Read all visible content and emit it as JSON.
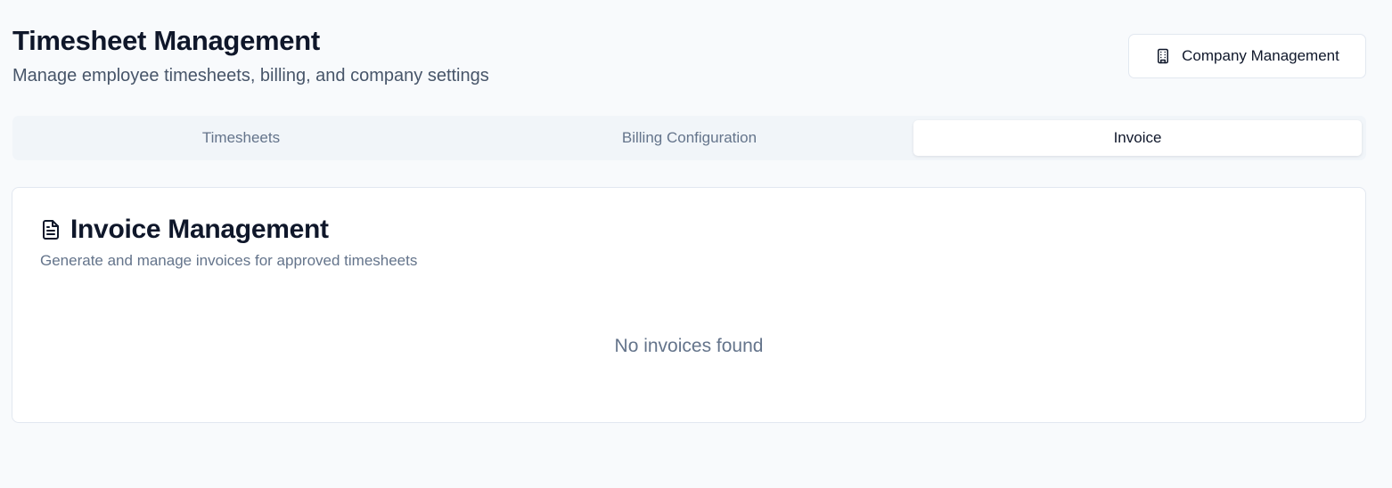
{
  "header": {
    "title": "Timesheet Management",
    "subtitle": "Manage employee timesheets, billing, and company settings",
    "company_button": {
      "label": "Company Management",
      "icon": "building-icon"
    }
  },
  "tabs": [
    {
      "label": "Timesheets",
      "active": false
    },
    {
      "label": "Billing Configuration",
      "active": false
    },
    {
      "label": "Invoice",
      "active": true
    }
  ],
  "invoice_card": {
    "icon": "file-text-icon",
    "title": "Invoice Management",
    "description": "Generate and manage invoices for approved timesheets",
    "empty_message": "No invoices found"
  },
  "colors": {
    "background": "#f8fafc",
    "tab_bar": "#f1f5f9",
    "text_primary": "#0f172a",
    "text_muted": "#64748b",
    "border": "#e2e8f0"
  }
}
